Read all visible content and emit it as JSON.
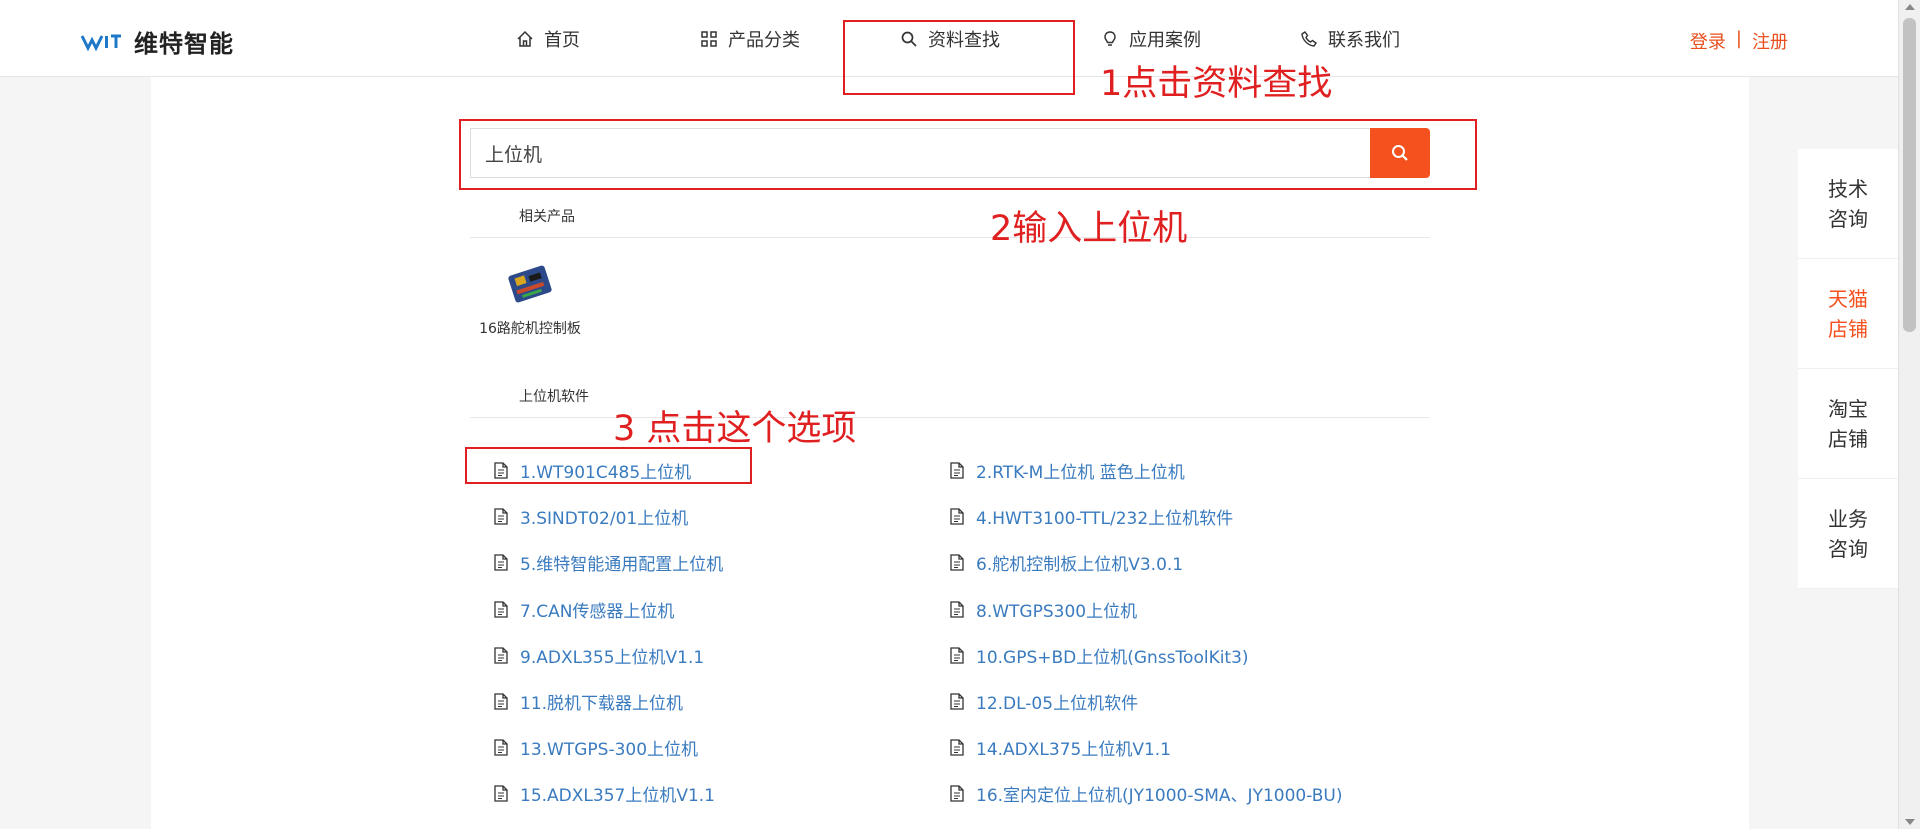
{
  "brand": {
    "name": "维特智能"
  },
  "nav": {
    "items": [
      {
        "label": "首页",
        "icon": "home-icon"
      },
      {
        "label": "产品分类",
        "icon": "grid-icon"
      },
      {
        "label": "资料查找",
        "icon": "search-icon"
      },
      {
        "label": "应用案例",
        "icon": "lightbulb-icon"
      },
      {
        "label": "联系我们",
        "icon": "phone-icon"
      }
    ],
    "active_index": 2
  },
  "auth": {
    "login": "登录",
    "separator": "|",
    "register": "注册"
  },
  "search": {
    "value": "上位机"
  },
  "sections": {
    "products_title": "相关产品",
    "software_title": "上位机软件"
  },
  "products": [
    {
      "name": "16路舵机控制板"
    }
  ],
  "results": [
    "1.WT901C485上位机",
    "2.RTK-M上位机 蓝色上位机",
    "3.SINDT02/01上位机",
    "4.HWT3100-TTL/232上位机软件",
    "5.维特智能通用配置上位机",
    "6.舵机控制板上位机V3.0.1",
    "7.CAN传感器上位机",
    "8.WTGPS300上位机",
    "9.ADXL355上位机V1.1",
    "10.GPS+BD上位机(GnssToolKit3)",
    "11.脱机下载器上位机",
    "12.DL-05上位机软件",
    "13.WTGPS-300上位机",
    "14.ADXL375上位机V1.1",
    "15.ADXL357上位机V1.1",
    "16.室内定位上位机(JY1000-SMA、JY1000-BU)"
  ],
  "side": [
    {
      "line1": "技术",
      "line2": "咨询"
    },
    {
      "line1": "天猫",
      "line2": "店铺"
    },
    {
      "line1": "淘宝",
      "line2": "店铺"
    },
    {
      "line1": "业务",
      "line2": "咨询"
    }
  ],
  "annotations": {
    "step1": "1点击资料查找",
    "step2": "2输入上位机",
    "step3": "3 点击这个选项"
  },
  "colors": {
    "accent": "#f4511e",
    "link": "#3a7bbf",
    "annotation": "#e02020"
  }
}
